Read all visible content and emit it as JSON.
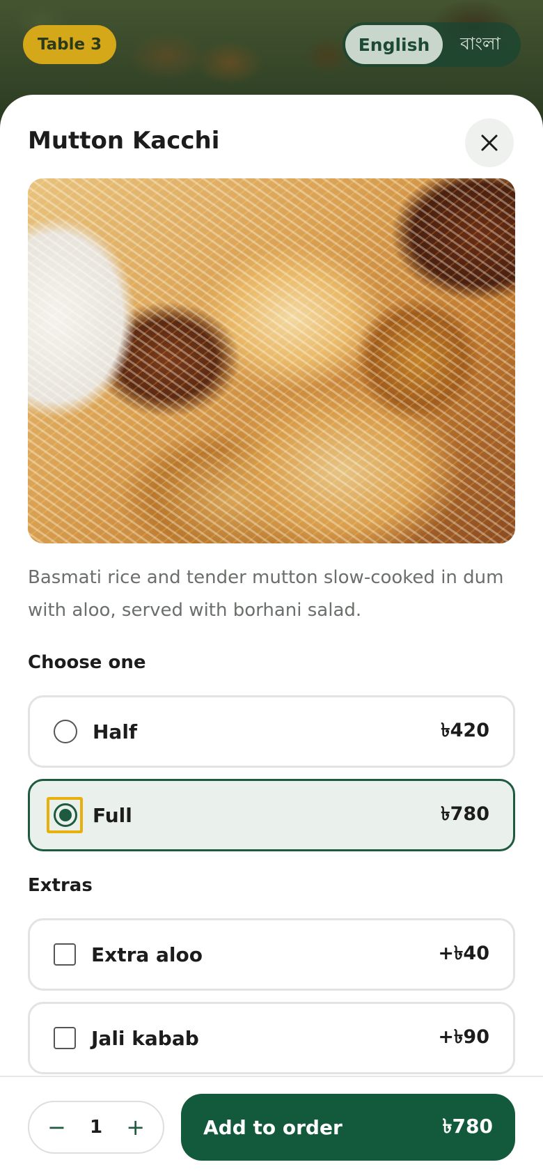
{
  "header": {
    "table_label": "Table 3",
    "languages": [
      {
        "label": "English",
        "active": true
      },
      {
        "label": "বাংলা",
        "active": false
      }
    ]
  },
  "item": {
    "title": "Mutton Kacchi",
    "close_icon": "close-icon",
    "description": "Basmati rice and tender mutton slow-cooked in dum with aloo, served with borhani salad."
  },
  "choose_one": {
    "label": "Choose one",
    "options": [
      {
        "label": "Half",
        "price": "৳420",
        "selected": false
      },
      {
        "label": "Full",
        "price": "৳780",
        "selected": true
      }
    ]
  },
  "extras": {
    "label": "Extras",
    "options": [
      {
        "label": "Extra aloo",
        "price": "+৳40",
        "checked": false
      },
      {
        "label": "Jali kabab",
        "price": "+৳90",
        "checked": false
      }
    ]
  },
  "order": {
    "quantity": "1",
    "minus_symbol": "−",
    "plus_symbol": "+",
    "add_label": "Add to order",
    "total": "৳780"
  },
  "colors": {
    "brand_green": "#135a3d",
    "accent_yellow": "#d4a818",
    "selected_bg": "#eaf1ec"
  }
}
